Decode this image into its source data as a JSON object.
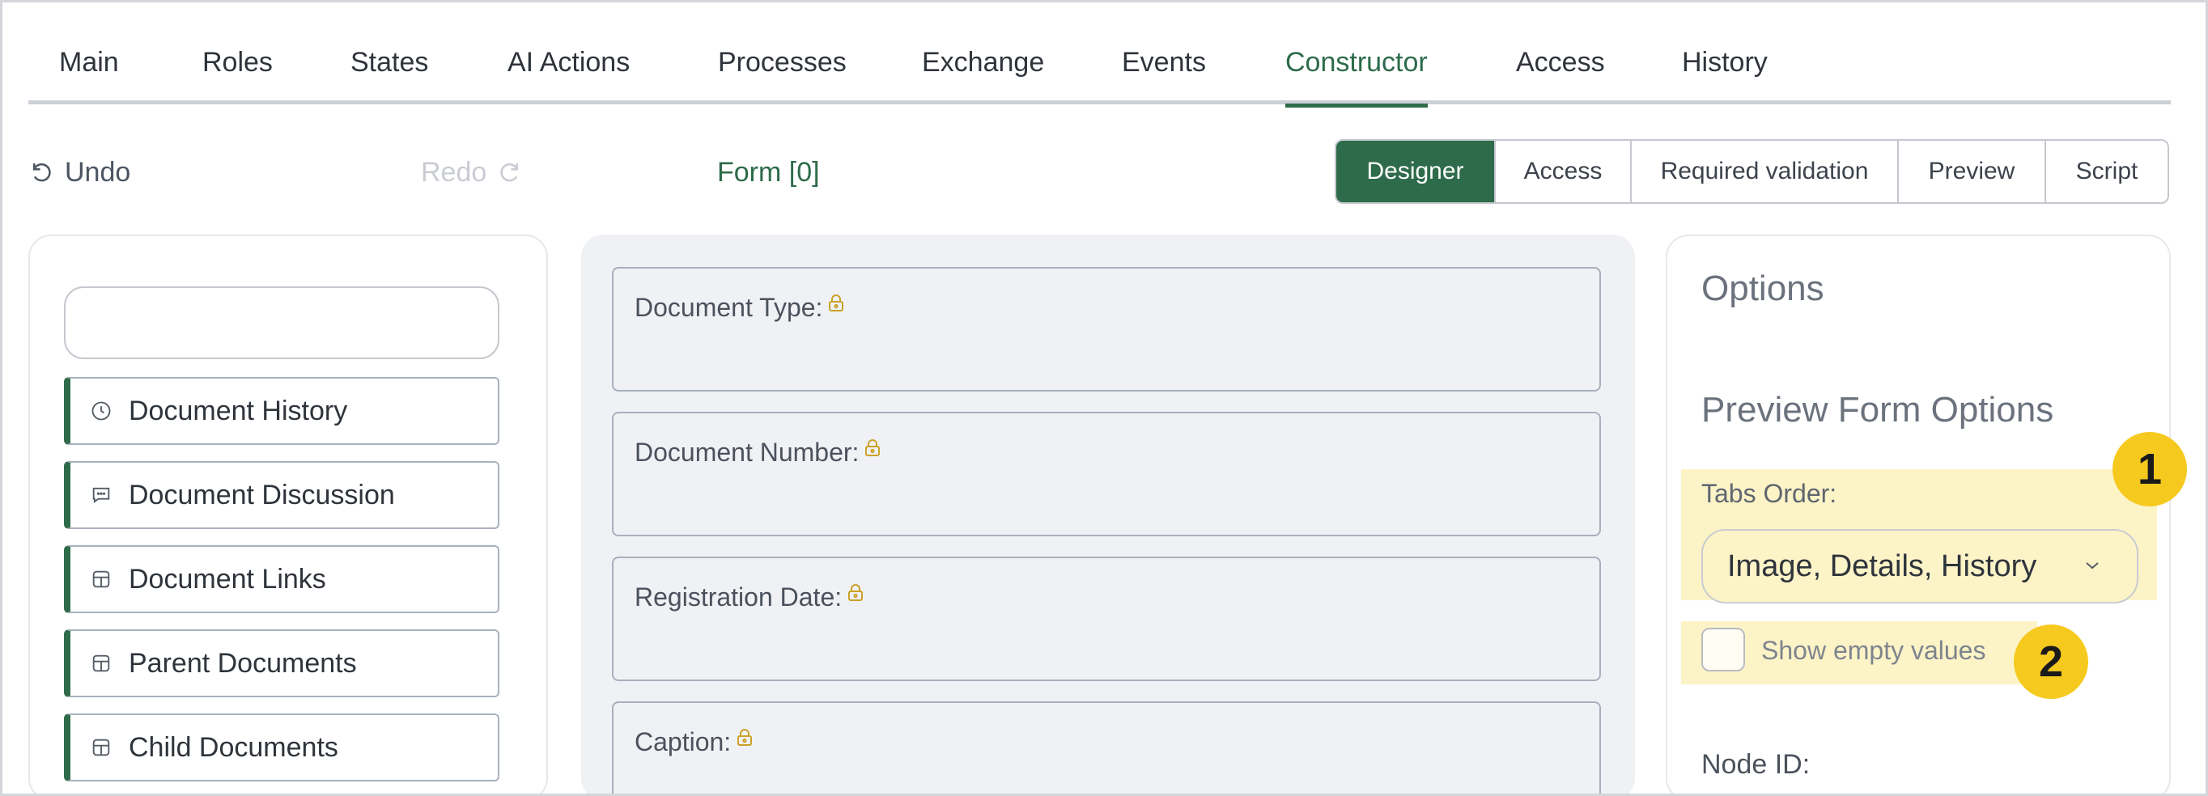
{
  "tabs": [
    {
      "label": "Main",
      "active": false
    },
    {
      "label": "Roles",
      "active": false
    },
    {
      "label": "States",
      "active": false
    },
    {
      "label": "AI Actions",
      "active": false
    },
    {
      "label": "Processes",
      "active": false
    },
    {
      "label": "Exchange",
      "active": false
    },
    {
      "label": "Events",
      "active": false
    },
    {
      "label": "Constructor",
      "active": true
    },
    {
      "label": "Access",
      "active": false
    },
    {
      "label": "History",
      "active": false
    }
  ],
  "toolbar": {
    "undo_label": "Undo",
    "redo_label": "Redo",
    "form_label": "Form [0]",
    "modes": [
      "Designer",
      "Access",
      "Required validation",
      "Preview",
      "Script"
    ],
    "active_mode": "Designer"
  },
  "components": {
    "search_placeholder": "",
    "items": [
      {
        "label": "Document History",
        "icon": "clock-icon"
      },
      {
        "label": "Document Discussion",
        "icon": "chat-icon"
      },
      {
        "label": "Document Links",
        "icon": "layout-icon"
      },
      {
        "label": "Parent Documents",
        "icon": "layout-icon"
      },
      {
        "label": "Child Documents",
        "icon": "layout-icon"
      }
    ]
  },
  "canvas": {
    "fields": [
      {
        "label": "Document Type:"
      },
      {
        "label": "Document Number:"
      },
      {
        "label": "Registration Date:"
      },
      {
        "label": "Caption:"
      }
    ]
  },
  "options": {
    "title": "Options",
    "subtitle": "Preview Form Options",
    "tabs_order_label": "Tabs Order:",
    "tabs_order_value": "Image, Details, History",
    "show_empty_label": "Show empty values",
    "show_empty_checked": false,
    "node_id_label": "Node ID:"
  },
  "annotations": {
    "badge_1": "1",
    "badge_2": "2"
  },
  "colors": {
    "accent": "#2e6b4a",
    "highlight": "#fcf3c7",
    "badge": "#f6c91f"
  }
}
